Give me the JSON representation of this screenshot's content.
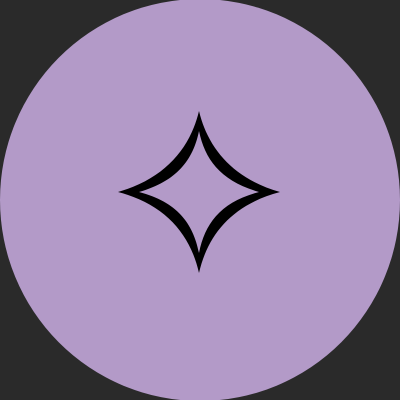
{
  "avatar": {
    "icon": "sparkle-star-icon",
    "circle_color": "#b39ac8",
    "background_color": "#2a2a2a",
    "icon_color": "#000000"
  }
}
